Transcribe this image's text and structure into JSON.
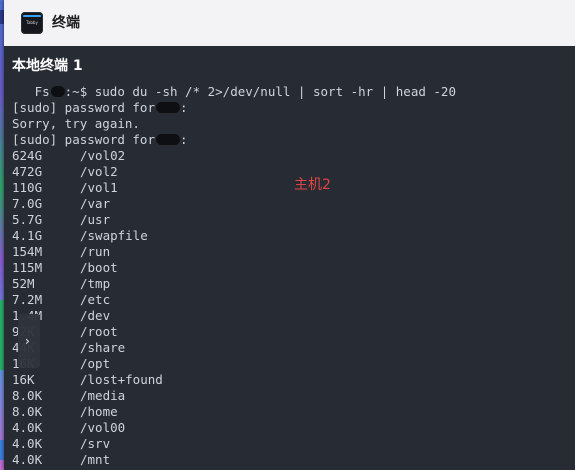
{
  "window": {
    "title": "终端"
  },
  "app_icon": {
    "text": "Tabby"
  },
  "tab": {
    "title": "本地终端 1"
  },
  "terminal": {
    "command_prefix": "   Fs",
    "command_host_tail": ":~$ sudo du -sh /* 2>/dev/null | sort -hr | head -20",
    "prompt_line_1": "[sudo] password for",
    "sorry_line": "Sorry, try again.",
    "prompt_line_2": "[sudo] password for",
    "colon": ":",
    "rows": [
      {
        "size": "624G",
        "path": "/vol02"
      },
      {
        "size": "472G",
        "path": "/vol2"
      },
      {
        "size": "110G",
        "path": "/vol1"
      },
      {
        "size": "7.0G",
        "path": "/var"
      },
      {
        "size": "5.7G",
        "path": "/usr"
      },
      {
        "size": "4.1G",
        "path": "/swapfile"
      },
      {
        "size": "154M",
        "path": "/run"
      },
      {
        "size": "115M",
        "path": "/boot"
      },
      {
        "size": "52M",
        "path": "/tmp"
      },
      {
        "size": "7.2M",
        "path": "/etc"
      },
      {
        "size": "1.4M",
        "path": "/dev"
      },
      {
        "size": "92K",
        "path": "/root"
      },
      {
        "size": "44K",
        "path": "/share"
      },
      {
        "size": "16K",
        "path": "/opt"
      },
      {
        "size": "16K",
        "path": "/lost+found"
      },
      {
        "size": "8.0K",
        "path": "/media"
      },
      {
        "size": "8.0K",
        "path": "/home"
      },
      {
        "size": "4.0K",
        "path": "/vol00"
      },
      {
        "size": "4.0K",
        "path": "/srv"
      },
      {
        "size": "4.0K",
        "path": "/mnt"
      }
    ]
  },
  "annotation": {
    "host_label": "主机2"
  },
  "side_handle": {
    "arrow": "›"
  }
}
